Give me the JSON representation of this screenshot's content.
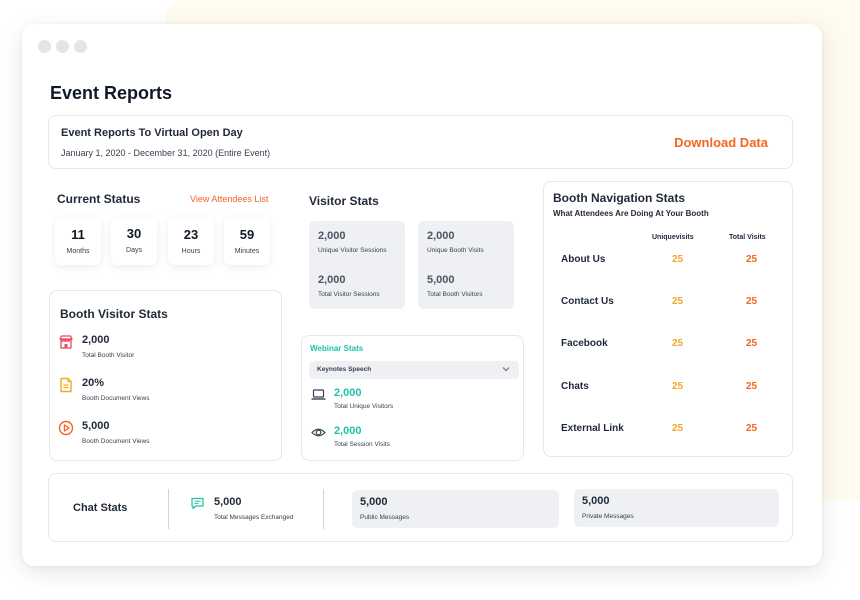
{
  "page_title": "Event Reports",
  "header": {
    "title": "Event Reports To Virtual Open Day",
    "date_range": "January 1, 2020 - December 31, 2020 (Entire Event)",
    "download_label": "Download Data"
  },
  "current_status": {
    "title": "Current Status",
    "link_label": "View Attendees List",
    "countdown": [
      {
        "value": "11",
        "label": "Months"
      },
      {
        "value": "30",
        "label": "Days"
      },
      {
        "value": "23",
        "label": "Hours"
      },
      {
        "value": "59",
        "label": "Minutes"
      }
    ]
  },
  "visitor_stats": {
    "title": "Visitor Stats",
    "items": [
      {
        "value": "2,000",
        "label": "Unique Visitor Sessions"
      },
      {
        "value": "2,000",
        "label": "Total Visitor Sessions"
      },
      {
        "value": "2,000",
        "label": "Unique Booth Visits"
      },
      {
        "value": "5,000",
        "label": "Total Booth Visitors"
      }
    ]
  },
  "booth_visitor_stats": {
    "title": "Booth Visitor Stats",
    "items": [
      {
        "value": "2,000",
        "label": "Total Booth Visitor",
        "icon": "store-icon",
        "color": "#e84a5f"
      },
      {
        "value": "20%",
        "label": "Booth Document Views",
        "icon": "document-icon",
        "color": "#f5a623"
      },
      {
        "value": "5,000",
        "label": "Booth Document Views",
        "icon": "play-circle-icon",
        "color": "#f26522"
      }
    ]
  },
  "webinar_stats": {
    "title": "Webinar Stats",
    "selected": "Keynotes Speech",
    "items": [
      {
        "value": "2,000",
        "label": "Total Unique Visitors",
        "icon": "laptop-icon"
      },
      {
        "value": "2,000",
        "label": "Total Session Visits",
        "icon": "eye-icon"
      }
    ]
  },
  "booth_navigation": {
    "title": "Booth Navigation Stats",
    "subtitle": "What Attendees Are Doing At Your Booth",
    "columns": [
      "Uniquevisits",
      "Total Visits"
    ],
    "rows": [
      {
        "name": "About Us",
        "unique": "25",
        "total": "25"
      },
      {
        "name": "Contact Us",
        "unique": "25",
        "total": "25"
      },
      {
        "name": "Facebook",
        "unique": "25",
        "total": "25"
      },
      {
        "name": "Chats",
        "unique": "25",
        "total": "25"
      },
      {
        "name": "External Link",
        "unique": "25",
        "total": "25"
      }
    ]
  },
  "chat_stats": {
    "title": "Chat Stats",
    "exchanged": {
      "value": "5,000",
      "label": "Total Messages Exchanged",
      "icon": "chat-icon"
    },
    "public": {
      "value": "5,000",
      "label": "Public Messages"
    },
    "private": {
      "value": "5,000",
      "label": "Private Messages"
    }
  },
  "colors": {
    "accent_orange": "#f26522",
    "accent_yellow": "#f5a623",
    "accent_teal": "#1fc1a6"
  }
}
